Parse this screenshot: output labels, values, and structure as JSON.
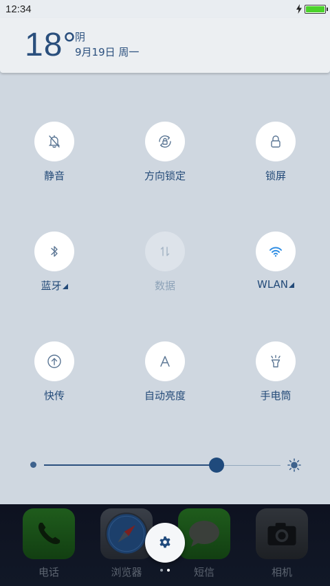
{
  "status_bar": {
    "time": "12:34"
  },
  "weather": {
    "temperature": "18°",
    "condition": "阴",
    "date": "9月19日 周一"
  },
  "toggles": [
    {
      "label": "静音",
      "icon": "bell-off-icon",
      "active": false
    },
    {
      "label": "方向锁定",
      "icon": "rotation-lock-icon",
      "active": false
    },
    {
      "label": "锁屏",
      "icon": "lock-icon",
      "active": false
    },
    {
      "label": "蓝牙",
      "icon": "bluetooth-icon",
      "active": false,
      "has_menu": true
    },
    {
      "label": "数据",
      "icon": "mobile-data-icon",
      "active": false,
      "disabled": true
    },
    {
      "label": "WLAN",
      "icon": "wifi-icon",
      "active": true,
      "has_menu": true
    },
    {
      "label": "快传",
      "icon": "quick-transfer-icon",
      "active": false
    },
    {
      "label": "自动亮度",
      "icon": "auto-brightness-icon",
      "active": false
    },
    {
      "label": "手电筒",
      "icon": "flashlight-icon",
      "active": false
    }
  ],
  "brightness": {
    "level_fraction": 0.73
  },
  "dock": {
    "apps": [
      {
        "label": "电话",
        "icon": "phone-icon"
      },
      {
        "label": "浏览器",
        "icon": "compass-icon"
      },
      {
        "label": "短信",
        "icon": "message-icon"
      },
      {
        "label": "相机",
        "icon": "camera-icon"
      }
    ],
    "pages": 2,
    "current_page": 1
  },
  "colors": {
    "accent": "#234a78",
    "panel_bg": "#cfd7e0",
    "wifi_active": "#2f8ee4",
    "battery": "#4ad22b"
  }
}
